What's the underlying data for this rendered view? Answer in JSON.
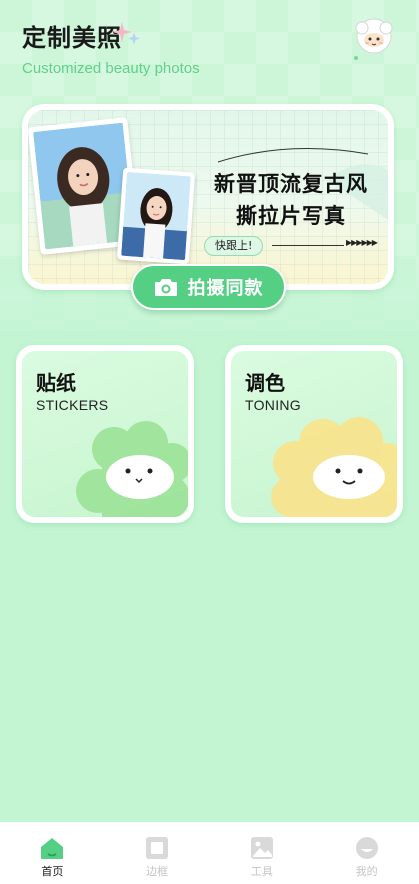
{
  "header": {
    "title": "定制美照",
    "subtitle": "Customized beauty photos"
  },
  "banner": {
    "headline_line1": "新晋顶流复古风",
    "headline_line2": "撕拉片写真",
    "chip_label": "快跟上!",
    "cta_label": "拍摄同款"
  },
  "cards": [
    {
      "title": "贴纸",
      "subtitle": "STICKERS",
      "color": "#9ee39a"
    },
    {
      "title": "调色",
      "subtitle": "TONING",
      "color": "#f8e48e"
    }
  ],
  "tabs": [
    {
      "label": "首页",
      "icon": "home-icon",
      "active": true
    },
    {
      "label": "边框",
      "icon": "frame-icon",
      "active": false
    },
    {
      "label": "工具",
      "icon": "image-icon",
      "active": false
    },
    {
      "label": "我的",
      "icon": "profile-icon",
      "active": false
    }
  ],
  "colors": {
    "background": "#c3f5d3",
    "accent": "#54cf84",
    "subtitle": "#5fd08a"
  }
}
